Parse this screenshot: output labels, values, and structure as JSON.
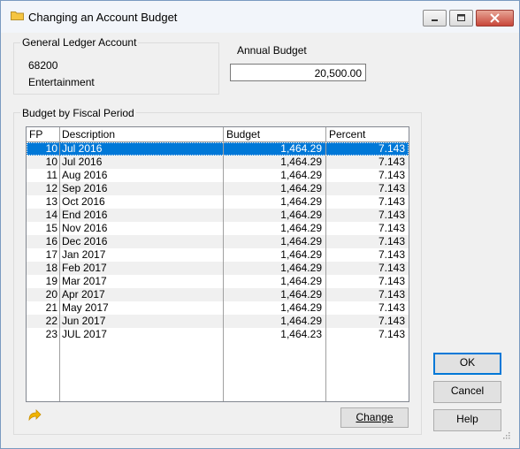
{
  "window": {
    "title": "Changing an Account Budget",
    "icon": "folder-icon"
  },
  "gl_account": {
    "label": "General Ledger Account",
    "number": "68200",
    "name": "Entertainment"
  },
  "annual_budget": {
    "label": "Annual Budget",
    "value": "20,500.00"
  },
  "fiscal": {
    "label": "Budget by Fiscal Period",
    "columns": [
      "FP",
      "Description",
      "Budget",
      "Percent"
    ],
    "rows": [
      {
        "fp": "10",
        "desc": "Jul 2016",
        "budget": "1,464.29",
        "pct": "7.143"
      },
      {
        "fp": "10",
        "desc": "Jul 2016",
        "budget": "1,464.29",
        "pct": "7.143"
      },
      {
        "fp": "11",
        "desc": "Aug 2016",
        "budget": "1,464.29",
        "pct": "7.143"
      },
      {
        "fp": "12",
        "desc": "Sep 2016",
        "budget": "1,464.29",
        "pct": "7.143"
      },
      {
        "fp": "13",
        "desc": "Oct 2016",
        "budget": "1,464.29",
        "pct": "7.143"
      },
      {
        "fp": "14",
        "desc": "End 2016",
        "budget": "1,464.29",
        "pct": "7.143"
      },
      {
        "fp": "15",
        "desc": "Nov 2016",
        "budget": "1,464.29",
        "pct": "7.143"
      },
      {
        "fp": "16",
        "desc": "Dec 2016",
        "budget": "1,464.29",
        "pct": "7.143"
      },
      {
        "fp": "17",
        "desc": "Jan 2017",
        "budget": "1,464.29",
        "pct": "7.143"
      },
      {
        "fp": "18",
        "desc": "Feb 2017",
        "budget": "1,464.29",
        "pct": "7.143"
      },
      {
        "fp": "19",
        "desc": "Mar 2017",
        "budget": "1,464.29",
        "pct": "7.143"
      },
      {
        "fp": "20",
        "desc": "Apr 2017",
        "budget": "1,464.29",
        "pct": "7.143"
      },
      {
        "fp": "21",
        "desc": "May 2017",
        "budget": "1,464.29",
        "pct": "7.143"
      },
      {
        "fp": "22",
        "desc": "Jun 2017",
        "budget": "1,464.29",
        "pct": "7.143"
      },
      {
        "fp": "23",
        "desc": "JUL 2017",
        "budget": "1,464.23",
        "pct": "7.143"
      }
    ],
    "selected_row": 0
  },
  "buttons": {
    "change": "Change",
    "ok": "OK",
    "cancel": "Cancel",
    "help": "Help"
  },
  "colors": {
    "selection": "#0078d7",
    "accent_arrow": "#f0b400",
    "folder": "#f5c542"
  }
}
